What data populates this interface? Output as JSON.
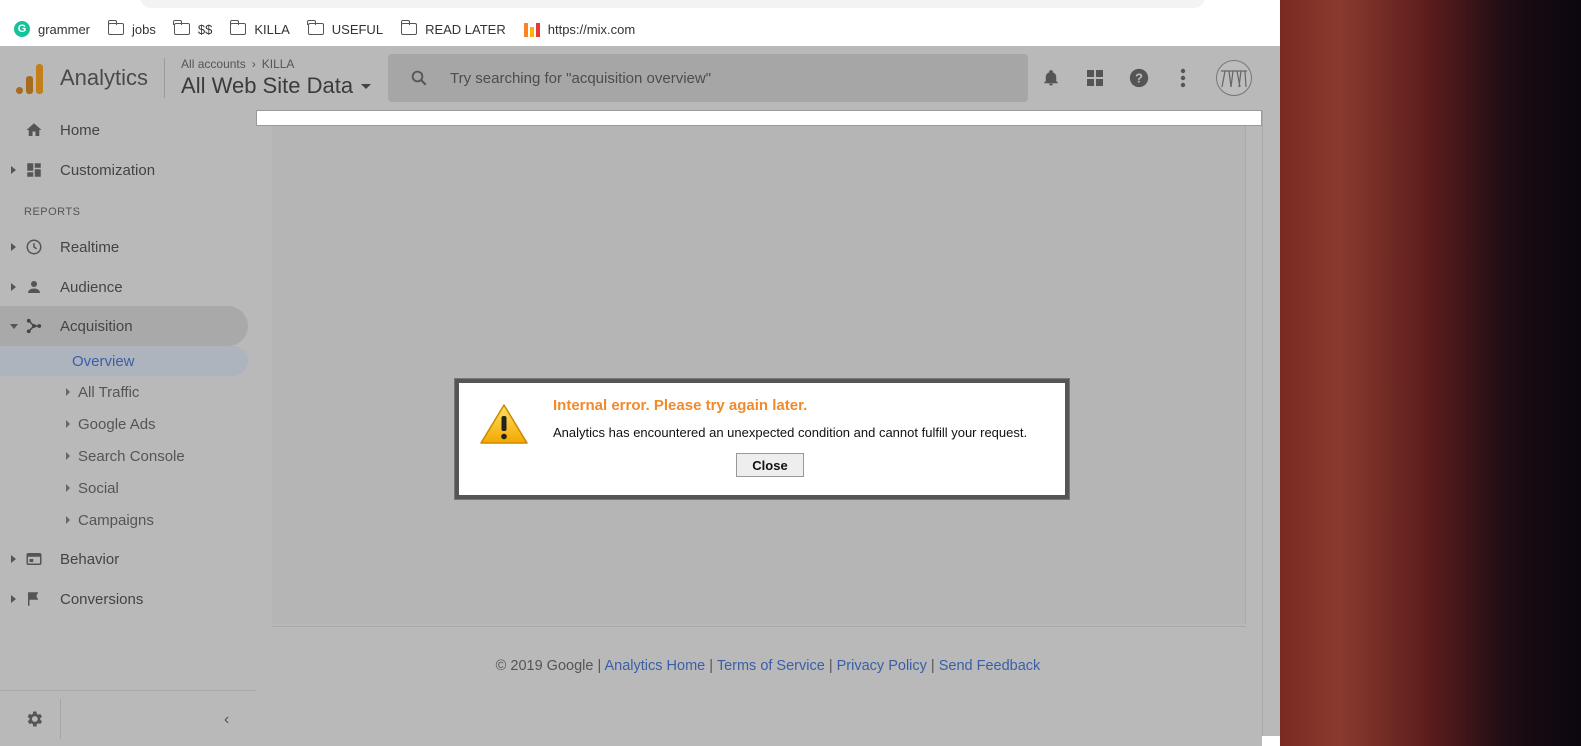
{
  "bookmarks": [
    {
      "label": "grammer",
      "icon": "grammarly-icon"
    },
    {
      "label": "jobs",
      "icon": "folder-icon"
    },
    {
      "label": "$$",
      "icon": "folder-icon"
    },
    {
      "label": "KILLA",
      "icon": "folder-icon"
    },
    {
      "label": "USEFUL",
      "icon": "folder-icon"
    },
    {
      "label": "READ LATER",
      "icon": "folder-icon"
    },
    {
      "label": "https://mix.com",
      "icon": "mix-icon"
    }
  ],
  "header": {
    "app_title": "Analytics",
    "breadcrumb_root": "All accounts",
    "breadcrumb_account": "KILLA",
    "property": "All Web Site Data",
    "search_placeholder": "Try searching for \"acquisition overview\""
  },
  "sidebar": {
    "home": "Home",
    "customization": "Customization",
    "reports_label": "REPORTS",
    "realtime": "Realtime",
    "audience": "Audience",
    "acquisition": "Acquisition",
    "acquisition_sub": [
      "Overview",
      "All Traffic",
      "Google Ads",
      "Search Console",
      "Social",
      "Campaigns"
    ],
    "behavior": "Behavior",
    "conversions": "Conversions"
  },
  "dialog": {
    "title": "Internal error. Please try again later.",
    "message": "Analytics has encountered an unexpected condition and cannot fulfill your request.",
    "close_label": "Close"
  },
  "footer": {
    "copyright": "© 2019 Google",
    "sep": "|",
    "links": [
      "Analytics Home",
      "Terms of Service",
      "Privacy Policy",
      "Send Feedback"
    ]
  },
  "colors": {
    "accent_link": "#3a5fa8",
    "error_title": "#f08a2b",
    "logo_orange": "#c47f1a"
  }
}
